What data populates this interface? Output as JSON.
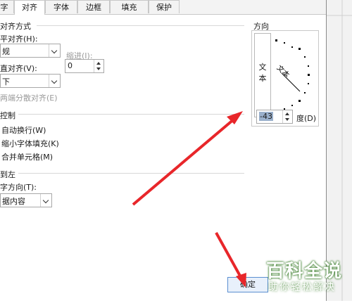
{
  "tabs": [
    "字",
    "对齐",
    "字体",
    "边框",
    "填充",
    "保护"
  ],
  "active_tab": "对齐",
  "alignment": {
    "group_title": "对齐方式",
    "horizontal_label": "平对齐(H):",
    "horizontal_value": "规",
    "indent_label": "缩进(I):",
    "indent_value": "0",
    "vertical_label": "直对齐(V):",
    "vertical_value": "下",
    "justify_distributed": "两端分散对齐(E)"
  },
  "text_control": {
    "group_title": "控制",
    "wrap": "自动换行(W)",
    "shrink": "缩小字体填充(K)",
    "merge": "合并单元格(M)"
  },
  "rtl": {
    "group_title": "到左",
    "direction_label": "字方向(T):",
    "direction_value": "据内容"
  },
  "orientation": {
    "title": "方向",
    "vertical_text": "文本",
    "dial_text": "文本",
    "degree_value": "-43",
    "degree_label": "度(D)"
  },
  "ok_button": "确定",
  "watermark": {
    "title": "百科全说",
    "subtitle": "助你轻松解决"
  },
  "colors": {
    "arrow": "#e8262a",
    "watermark_green": "#36b24a"
  }
}
